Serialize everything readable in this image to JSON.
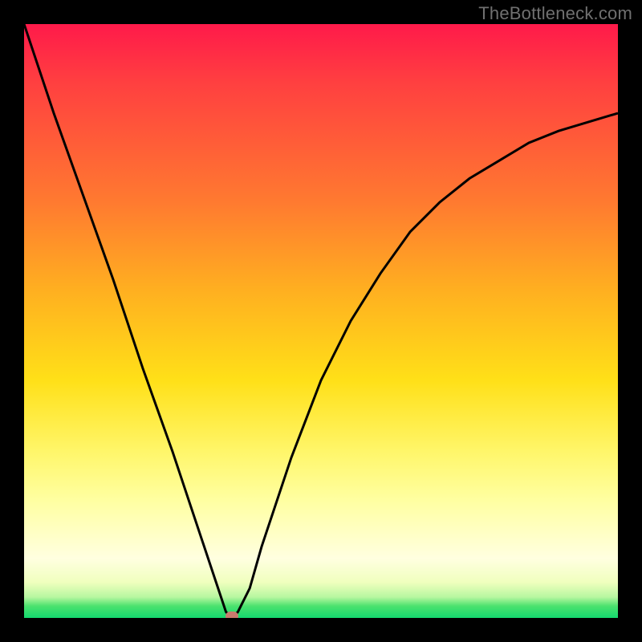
{
  "watermark": {
    "text": "TheBottleneck.com"
  },
  "colors": {
    "background": "#000000",
    "curve": "#000000",
    "marker": "#c97a6e",
    "gradient_stop_top": "#ff1a4a",
    "gradient_stop_bottom": "#14d96f"
  },
  "chart_data": {
    "type": "line",
    "title": "",
    "xlabel": "",
    "ylabel": "",
    "xlim": [
      0,
      100
    ],
    "ylim": [
      0,
      100
    ],
    "x": [
      0,
      5,
      10,
      15,
      20,
      25,
      30,
      33,
      34,
      35,
      36,
      38,
      40,
      45,
      50,
      55,
      60,
      65,
      70,
      75,
      80,
      85,
      90,
      95,
      100
    ],
    "values": [
      100,
      85,
      71,
      57,
      42,
      28,
      13,
      4,
      1,
      0,
      1,
      5,
      12,
      27,
      40,
      50,
      58,
      65,
      70,
      74,
      77,
      80,
      82,
      83.5,
      85
    ],
    "marker_point": {
      "x": 35,
      "y": 0
    },
    "note": "y represents bottleneck percentage (0 at bottom green, 100 at top red); curve dips to 0 near x≈35 and rises asymmetrically"
  }
}
